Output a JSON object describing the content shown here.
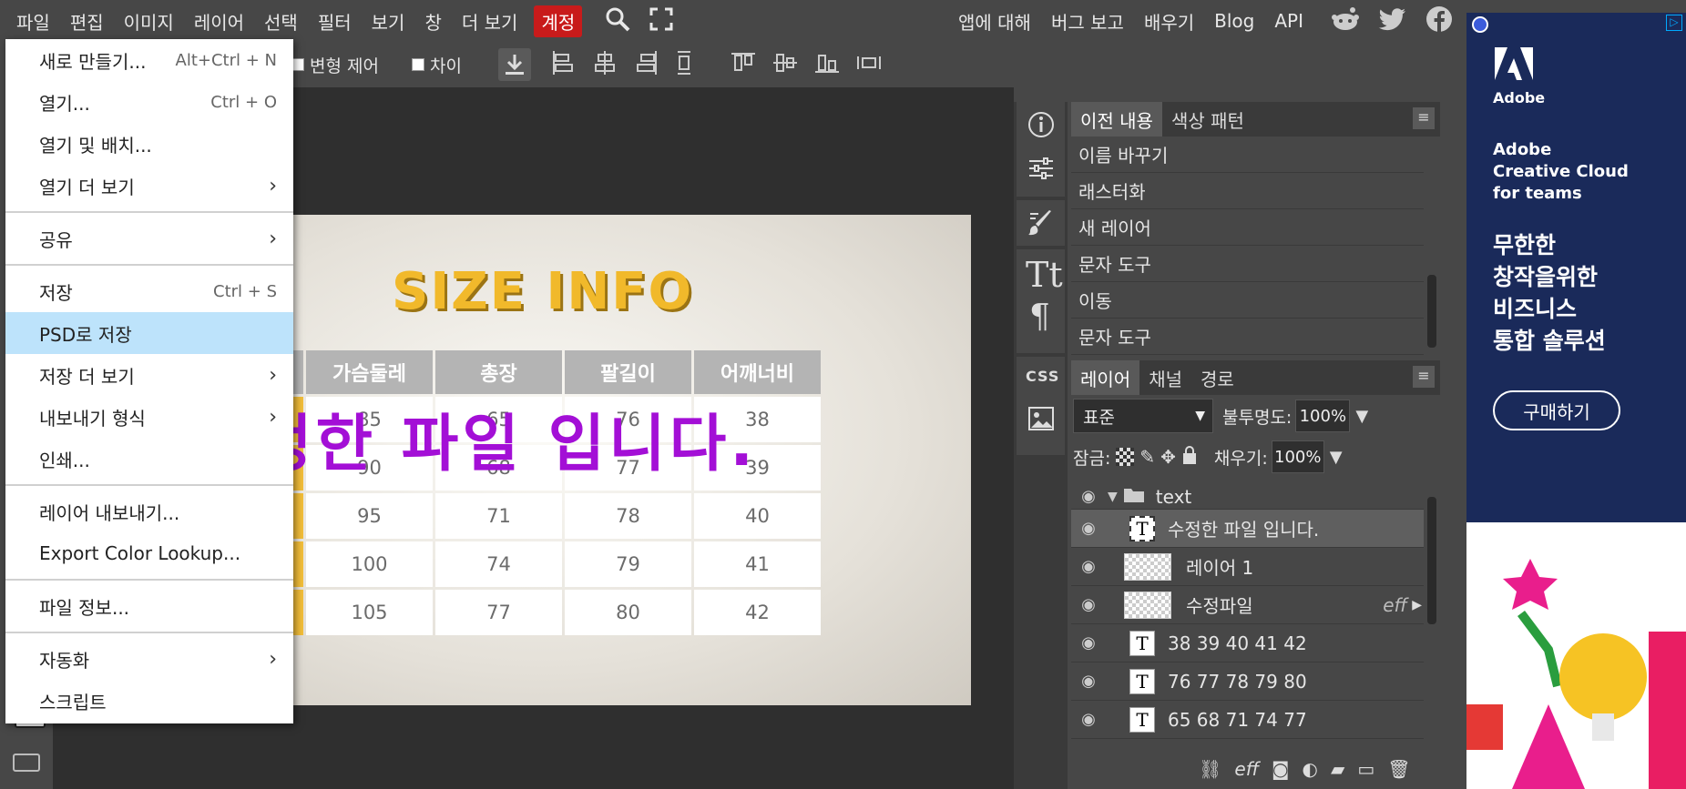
{
  "menubar": {
    "items": [
      "파일",
      "편집",
      "이미지",
      "레이어",
      "선택",
      "필터",
      "보기",
      "창",
      "더 보기"
    ],
    "account": "계정",
    "right": [
      "앱에 대해",
      "버그 보고",
      "배우기",
      "Blog",
      "API"
    ]
  },
  "options": {
    "transform_label": "변형 제어",
    "diff_label": "차이"
  },
  "file_menu": {
    "new": "새로 만들기...",
    "new_sc": "Alt+Ctrl + N",
    "open": "열기...",
    "open_sc": "Ctrl + O",
    "open_place": "열기 및 배치...",
    "open_more": "열기 더 보기",
    "share": "공유",
    "save": "저장",
    "save_sc": "Ctrl + S",
    "save_psd": "PSD로 저장",
    "save_more": "저장 더 보기",
    "export_as": "내보내기 형식",
    "print": "인쇄...",
    "export_layers": "레이어 내보내기...",
    "export_lookup": "Export Color Lookup...",
    "file_info": "파일 정보...",
    "automate": "자동화",
    "script": "스크립트"
  },
  "document": {
    "title": "SIZE INFO",
    "headers": [
      "가슴둘레",
      "총장",
      "팔길이",
      "어깨너비"
    ],
    "rows": [
      [
        "85",
        "65",
        "76",
        "38"
      ],
      [
        "90",
        "68",
        "77",
        "39"
      ],
      [
        "95",
        "71",
        "78",
        "40"
      ],
      [
        "100",
        "74",
        "79",
        "41"
      ],
      [
        "105",
        "77",
        "80",
        "42"
      ]
    ],
    "overlay": "정한 파일 입니다."
  },
  "history": {
    "tabs": [
      "이전 내용",
      "색상 패턴"
    ],
    "items": [
      "이름 바꾸기",
      "래스터화",
      "새 레이어",
      "문자 도구",
      "이동",
      "문자 도구"
    ]
  },
  "layers_panel": {
    "tabs": [
      "레이어",
      "채널",
      "경로"
    ],
    "blend": "표준",
    "opacity_label": "불투명도:",
    "opacity": "100%",
    "lock_label": "잠금:",
    "fill_label": "채우기:",
    "fill": "100%",
    "layers": [
      {
        "name": "text",
        "kind": "group"
      },
      {
        "name": "수정한 파일 입니다.",
        "kind": "text"
      },
      {
        "name": "레이어 1",
        "kind": "raster"
      },
      {
        "name": "수정파일",
        "kind": "raster",
        "fx": "eff"
      },
      {
        "name": "38 39 40 41 42",
        "kind": "text"
      },
      {
        "name": "76 77 78 79 80",
        "kind": "text"
      },
      {
        "name": "65 68 71 74 77",
        "kind": "text"
      }
    ]
  },
  "ad": {
    "brand": "Adobe",
    "line1": "Adobe",
    "line2": "Creative Cloud",
    "line3": "for teams",
    "h1": "무한한",
    "h2": "창작을위한",
    "h3": "비즈니스",
    "h4": "통합 솔루션",
    "cta": "구매하기"
  }
}
